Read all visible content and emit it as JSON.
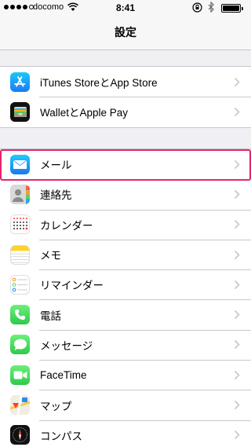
{
  "status_bar": {
    "carrier": "docomo",
    "time": "8:41",
    "signal_bars": 4,
    "signal_total": 5,
    "battery_level": 1.0
  },
  "nav": {
    "title": "設定"
  },
  "group1": [
    {
      "label": "iTunes StoreとApp Store",
      "icon": "app-store-icon",
      "color": "#1a8af6"
    },
    {
      "label": "WalletとApple Pay",
      "icon": "wallet-icon",
      "color": "#111111"
    }
  ],
  "group2": [
    {
      "label": "メール",
      "icon": "mail-icon",
      "color": "#1d8cf8"
    },
    {
      "label": "連絡先",
      "icon": "contacts-icon",
      "color": "#9d9d9d"
    },
    {
      "label": "カレンダー",
      "icon": "calendar-icon",
      "color": "#ffffff"
    },
    {
      "label": "メモ",
      "icon": "notes-icon",
      "color": "#ffd22e"
    },
    {
      "label": "リマインダー",
      "icon": "reminders-icon",
      "color": "#ffffff"
    },
    {
      "label": "電話",
      "icon": "phone-icon",
      "color": "#4cd964"
    },
    {
      "label": "メッセージ",
      "icon": "messages-icon",
      "color": "#4cd964"
    },
    {
      "label": "FaceTime",
      "icon": "facetime-icon",
      "color": "#4cd964"
    },
    {
      "label": "マップ",
      "icon": "maps-icon",
      "color": "#e9e6df"
    },
    {
      "label": "コンパス",
      "icon": "compass-icon",
      "color": "#111111"
    }
  ],
  "highlight_color": "#e5256b"
}
